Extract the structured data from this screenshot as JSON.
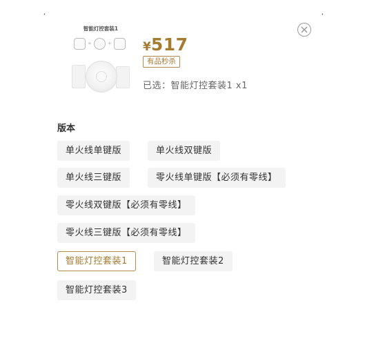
{
  "product_image": {
    "title": "智能灯控套装1"
  },
  "price": {
    "currency": "¥",
    "value": "517"
  },
  "badge": "有品秒杀",
  "selected": "已选：智能灯控套装1 x1",
  "close_icon": "close-circle-icon",
  "section_title": "版本",
  "options": [
    {
      "label": "单火线单键版",
      "selected": false
    },
    {
      "label": "单火线双键版",
      "selected": false
    },
    {
      "label": "单火线三键版",
      "selected": false
    },
    {
      "label": "零火线单键版【必须有零线】",
      "selected": false
    },
    {
      "label": "零火线双键版【必须有零线】",
      "selected": false
    },
    {
      "label": "零火线三键版【必须有零线】",
      "selected": false
    },
    {
      "label": "智能灯控套装1",
      "selected": true
    },
    {
      "label": "智能灯控套装2",
      "selected": false
    },
    {
      "label": "智能灯控套装3",
      "selected": false
    }
  ],
  "colors": {
    "accent": "#a57b32",
    "option_bg": "#f3f3f3",
    "text": "#333333"
  }
}
